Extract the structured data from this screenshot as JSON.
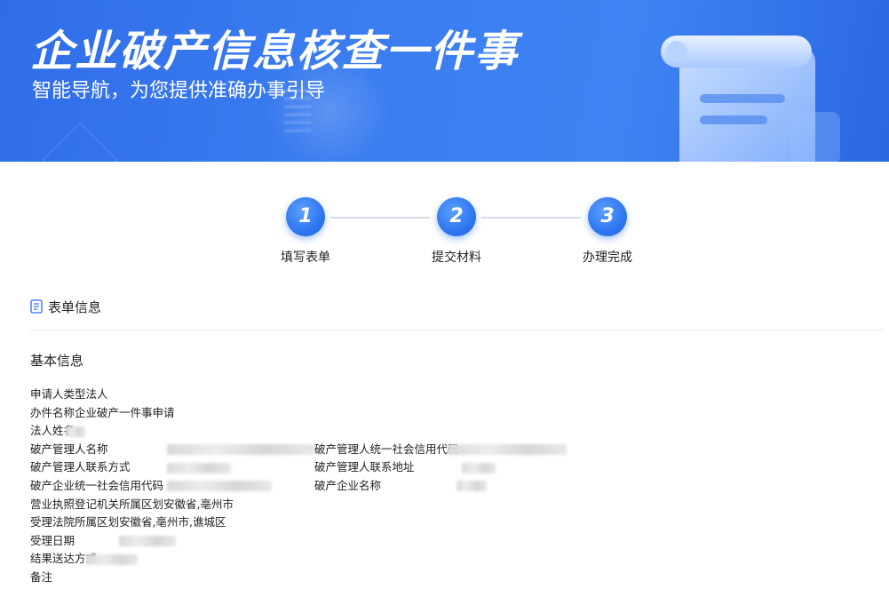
{
  "banner": {
    "title": "企业破产信息核查一件事",
    "subtitle": "智能导航，为您提供准确办事引导"
  },
  "steps": [
    {
      "number": "1",
      "label": "填写表单"
    },
    {
      "number": "2",
      "label": "提交材料"
    },
    {
      "number": "3",
      "label": "办理完成"
    }
  ],
  "section": {
    "title": "表单信息",
    "subsection_title": "基本信息"
  },
  "form": {
    "applicant_type_label": "申请人类型",
    "applicant_type_value": "法人",
    "item_name_label": "办件名称",
    "item_name_value": "企业破产一件事申请",
    "legal_person_label": "法人姓名",
    "administrator_name_label": "破产管理人名称",
    "administrator_credit_code_label": "破产管理人统一社会信用代码",
    "administrator_phone_label": "破产管理人联系方式",
    "administrator_address_label": "破产管理人联系地址",
    "enterprise_credit_code_label": "破产企业统一社会信用代码",
    "enterprise_name_label": "破产企业名称",
    "registration_division_label": "营业执照登记机关所属区划",
    "registration_division_value": "安徽省,亳州市",
    "court_division_label": "受理法院所属区划",
    "court_division_value": "安徽省,亳州市,谯城区",
    "acceptance_date_label": "受理日期",
    "delivery_method_label": "结果送达方式",
    "remarks_label": "备注"
  },
  "colors": {
    "brand_blue": "#2f6de8",
    "step_blue": "#2f76f0"
  }
}
